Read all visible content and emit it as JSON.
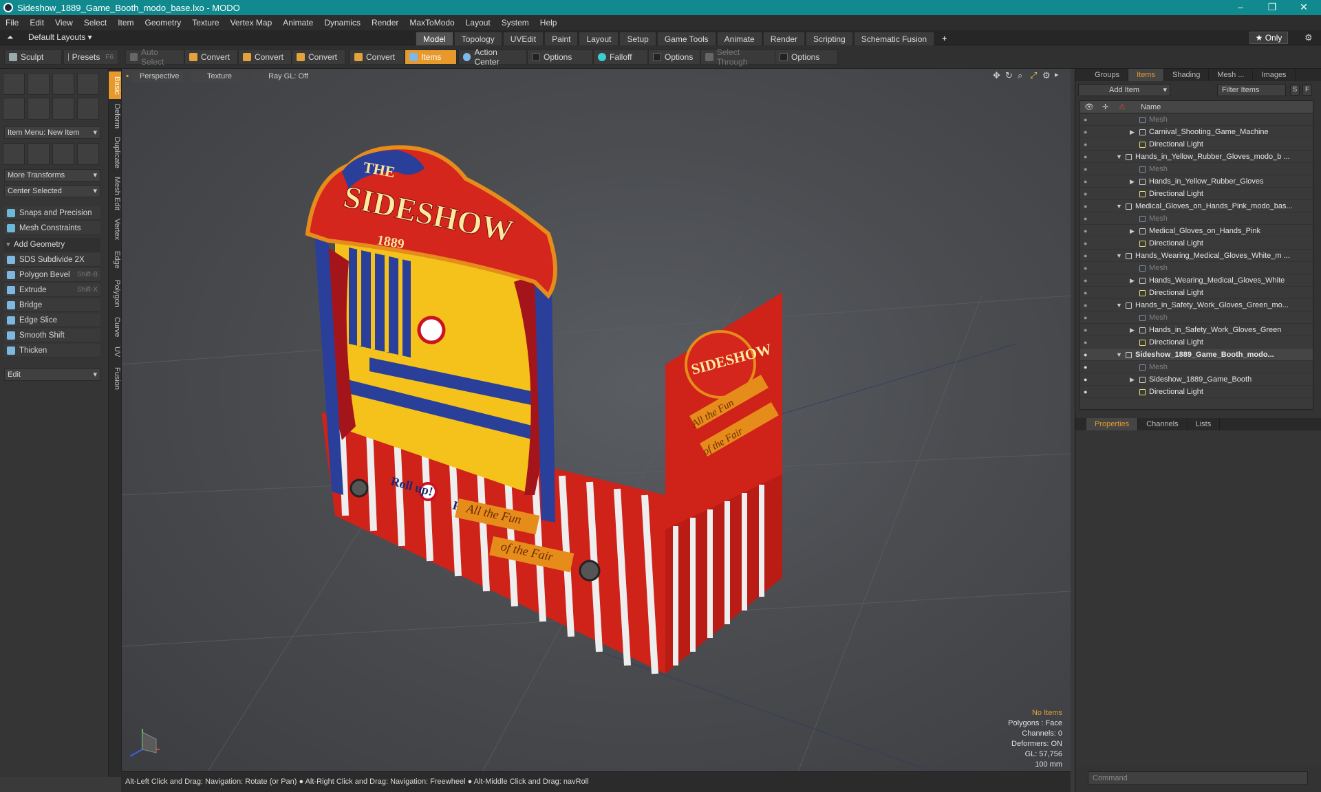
{
  "window": {
    "title": "Sideshow_1889_Game_Booth_modo_base.lxo - MODO",
    "controls": [
      "–",
      "❐",
      "✕"
    ]
  },
  "menu": [
    "File",
    "Edit",
    "View",
    "Select",
    "Item",
    "Geometry",
    "Texture",
    "Vertex Map",
    "Animate",
    "Dynamics",
    "Render",
    "MaxToModo",
    "Layout",
    "System",
    "Help"
  ],
  "layouts": {
    "label": "Default Layouts ▾"
  },
  "mode_tabs": [
    "Model",
    "Topology",
    "UVEdit",
    "Paint",
    "Layout",
    "Setup",
    "Game Tools",
    "Animate",
    "Render",
    "Scripting",
    "Schematic Fusion"
  ],
  "only_label": "★  Only",
  "toolbar": {
    "sculpt": "Sculpt",
    "presets": "Presets",
    "presets_key": "F6",
    "auto_select": "Auto Select",
    "convert": "Convert",
    "items": "Items",
    "action_center": "Action Center",
    "options": "Options",
    "falloff": "Falloff",
    "select_through": "Select Through"
  },
  "left_vtabs": [
    "Basic",
    "Deform",
    "Duplicate",
    "Mesh Edit",
    "Vertex",
    "Edge",
    "Polygon",
    "Curve",
    "UV",
    "Fusion"
  ],
  "left_panel": {
    "item_menu": "Item Menu: New Item",
    "more_transforms": "More Transforms",
    "center_selected": "Center Selected",
    "snaps": "Snaps and Precision",
    "mesh_constraints": "Mesh Constraints",
    "add_geometry": "Add Geometry",
    "tools": [
      {
        "label": "SDS Subdivide 2X",
        "shortcut": ""
      },
      {
        "label": "Polygon Bevel",
        "shortcut": "Shift-B"
      },
      {
        "label": "Extrude",
        "shortcut": "Shift-X"
      },
      {
        "label": "Bridge",
        "shortcut": ""
      },
      {
        "label": "Edge Slice",
        "shortcut": ""
      },
      {
        "label": "Smooth Shift",
        "shortcut": ""
      },
      {
        "label": "Thicken",
        "shortcut": ""
      }
    ],
    "edit": "Edit"
  },
  "viewport": {
    "view": "Perspective",
    "shading": "Texture",
    "raygl": "Ray GL: Off",
    "hud": {
      "selection": "No Items",
      "polygons": "Polygons : Face",
      "channels": "Channels: 0",
      "deformers": "Deformers: ON",
      "gl": "GL: 57,756",
      "scale": "100 mm"
    },
    "booth": {
      "sign_the": "THE",
      "sign_main": "SIDESHOW",
      "sign_year": "1889",
      "rollup": "Roll up!",
      "banner1": "All the Fun",
      "banner2": "of the Fair",
      "colors": {
        "red": "#d4261c",
        "yellow": "#f4c21a",
        "blue": "#2a3f9a",
        "white": "#eeeeee",
        "gold": "#e58c1a"
      }
    }
  },
  "status_bar": "Alt-Left Click and Drag: Navigation: Rotate (or Pan) ● Alt-Right Click and Drag: Navigation: Freewheel ● Alt-Middle Click and Drag: navRoll",
  "right_panel": {
    "top_tabs": [
      "Groups",
      "Items",
      "Shading",
      "Mesh ...",
      "Images"
    ],
    "add_item": "Add Item",
    "filter_items": "Filter Items",
    "filter_btns": [
      "S",
      "F"
    ],
    "name_header": "Name",
    "rows": [
      {
        "label": "Mesh",
        "indent": 3,
        "type": "mesh",
        "dim": true
      },
      {
        "label": "Carnival_Shooting_Game_Machine",
        "indent": 3,
        "type": "item",
        "expand": true
      },
      {
        "label": "Directional Light",
        "indent": 3,
        "type": "light"
      },
      {
        "label": "Hands_in_Yellow_Rubber_Gloves_modo_b ...",
        "indent": 1,
        "type": "scene",
        "open": true
      },
      {
        "label": "Mesh",
        "indent": 3,
        "type": "mesh",
        "dim": true
      },
      {
        "label": "Hands_in_Yellow_Rubber_Gloves",
        "indent": 3,
        "type": "item",
        "expand": true
      },
      {
        "label": "Directional Light",
        "indent": 3,
        "type": "light"
      },
      {
        "label": "Medical_Gloves_on_Hands_Pink_modo_bas...",
        "indent": 1,
        "type": "scene",
        "open": true
      },
      {
        "label": "Mesh",
        "indent": 3,
        "type": "mesh",
        "dim": true
      },
      {
        "label": "Medical_Gloves_on_Hands_Pink",
        "indent": 3,
        "type": "item",
        "expand": true
      },
      {
        "label": "Directional Light",
        "indent": 3,
        "type": "light"
      },
      {
        "label": "Hands_Wearing_Medical_Gloves_White_m ...",
        "indent": 1,
        "type": "scene",
        "open": true
      },
      {
        "label": "Mesh",
        "indent": 3,
        "type": "mesh",
        "dim": true
      },
      {
        "label": "Hands_Wearing_Medical_Gloves_White",
        "indent": 3,
        "type": "item",
        "expand": true
      },
      {
        "label": "Directional Light",
        "indent": 3,
        "type": "light"
      },
      {
        "label": "Hands_in_Safety_Work_Gloves_Green_mo...",
        "indent": 1,
        "type": "scene",
        "open": true
      },
      {
        "label": "Mesh",
        "indent": 3,
        "type": "mesh",
        "dim": true
      },
      {
        "label": "Hands_in_Safety_Work_Gloves_Green",
        "indent": 3,
        "type": "item",
        "expand": true
      },
      {
        "label": "Directional Light",
        "indent": 3,
        "type": "light"
      },
      {
        "label": "Sideshow_1889_Game_Booth_modo...",
        "indent": 1,
        "type": "scene",
        "open": true,
        "selected": true
      },
      {
        "label": "Mesh",
        "indent": 3,
        "type": "mesh",
        "dim": true
      },
      {
        "label": "Sideshow_1889_Game_Booth",
        "indent": 3,
        "type": "item",
        "expand": true
      },
      {
        "label": "Directional Light",
        "indent": 3,
        "type": "light"
      }
    ],
    "bottom_tabs": [
      "Properties",
      "Channels",
      "Lists"
    ],
    "command_placeholder": "Command"
  }
}
